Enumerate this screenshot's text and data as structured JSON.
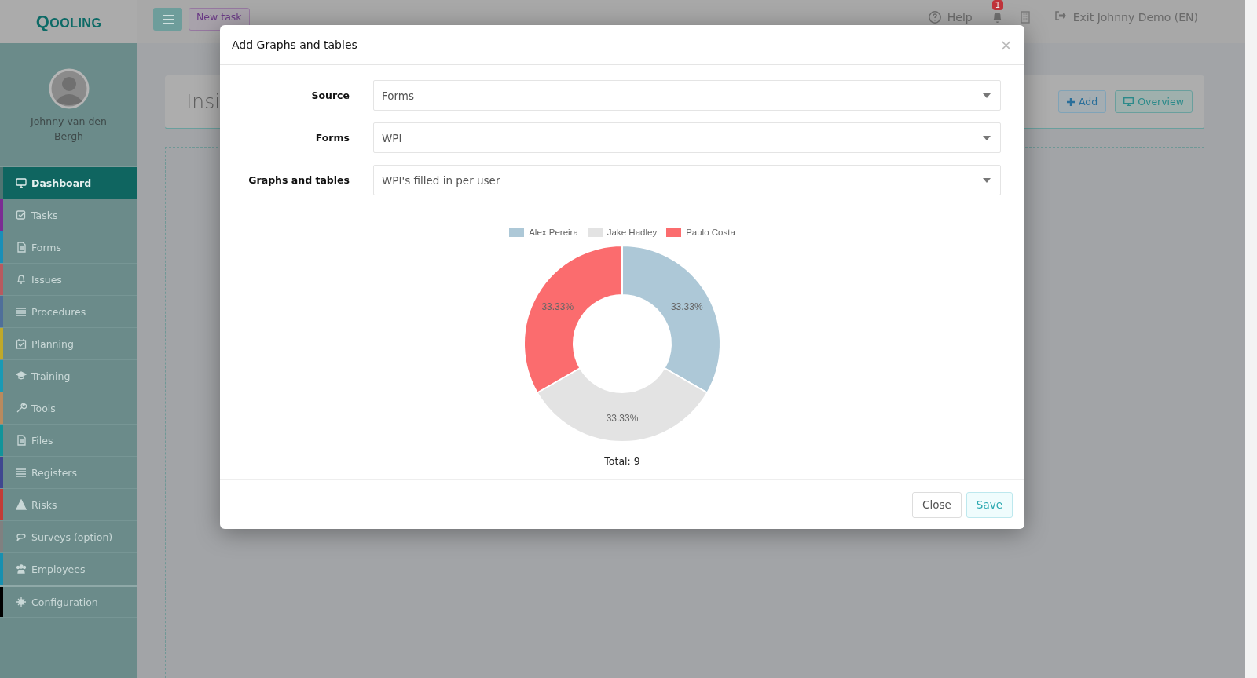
{
  "logo": "QOOLING",
  "topbar": {
    "new_task": "New task",
    "help": "Help",
    "notifications_badge": "1",
    "exit": "Exit Johnny Demo (EN)"
  },
  "profile": {
    "name": "Johnny van den Bergh"
  },
  "sidebar": {
    "items": [
      {
        "label": "Dashboard",
        "selected": true,
        "color": "#4f7472"
      },
      {
        "label": "Tasks",
        "selected": false,
        "color": "#7b2c93"
      },
      {
        "label": "Forms",
        "selected": false,
        "color": "#1a8fb8"
      },
      {
        "label": "Issues",
        "selected": false,
        "color": "#b85a5f"
      },
      {
        "label": "Procedures",
        "selected": false,
        "color": "#4f6f9a"
      },
      {
        "label": "Planning",
        "selected": false,
        "color": "#c0a92a"
      },
      {
        "label": "Training",
        "selected": false,
        "color": "#1a9ab5"
      },
      {
        "label": "Tools",
        "selected": false,
        "color": "#b98a5e"
      },
      {
        "label": "Files",
        "selected": false,
        "color": "#12949a"
      },
      {
        "label": "Registers",
        "selected": false,
        "color": "#3f4790"
      },
      {
        "label": "Risks",
        "selected": false,
        "color": "#c23b36"
      },
      {
        "label": "Surveys (option)",
        "selected": false,
        "color": "#808080"
      },
      {
        "label": "Employees",
        "selected": false,
        "color": "#1790b0"
      },
      {
        "label": "Configuration",
        "selected": false,
        "color": "#000000"
      }
    ]
  },
  "page": {
    "title": "Insi",
    "add": "Add",
    "overview": "Overview"
  },
  "modal": {
    "title": "Add Graphs and tables",
    "close_glyph": "×",
    "fields": [
      {
        "label": "Source",
        "value": "Forms"
      },
      {
        "label": "Forms",
        "value": "WPI"
      },
      {
        "label": "Graphs and tables",
        "value": "WPI's filled in per user"
      }
    ],
    "chart": {
      "slices": [
        {
          "color": "#adc8d7"
        },
        {
          "color": "#e3e3e3"
        },
        {
          "color": "#fb6c6e"
        }
      ],
      "chart_data": {
        "type": "donut",
        "categories": [
          "Alex Pereira",
          "Jake Hadley",
          "Paulo Costa"
        ],
        "values": [
          33.33,
          33.33,
          33.33
        ],
        "value_labels": [
          "33.33%",
          "33.33%",
          "33.33%"
        ],
        "legend": true
      },
      "total": "Total: 9"
    },
    "buttons": {
      "close": "Close",
      "save": "Save"
    }
  }
}
